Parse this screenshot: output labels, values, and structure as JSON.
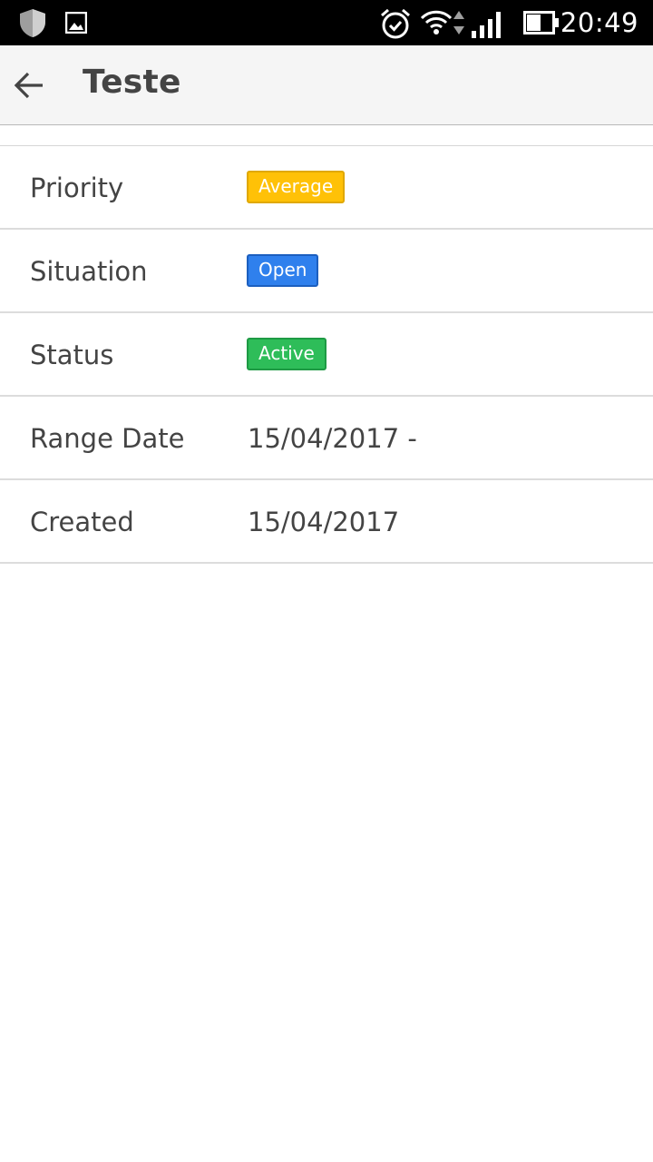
{
  "status_bar": {
    "time": "20:49",
    "icons": [
      "shield-icon",
      "image-icon",
      "alarm-icon",
      "wifi-icon",
      "data-arrows-icon",
      "signal-icon",
      "battery-icon"
    ]
  },
  "app_bar": {
    "back_icon": "arrow-left-icon",
    "title": "Teste"
  },
  "details": [
    {
      "label": "Priority",
      "badge": "Average",
      "badge_color": "#ffc107"
    },
    {
      "label": "Situation",
      "badge": "Open",
      "badge_color": "#2f80ed"
    },
    {
      "label": "Status",
      "badge": "Active",
      "badge_color": "#2ebd59"
    },
    {
      "label": "Range Date",
      "value": "15/04/2017 -"
    },
    {
      "label": "Created",
      "value": "15/04/2017"
    }
  ]
}
